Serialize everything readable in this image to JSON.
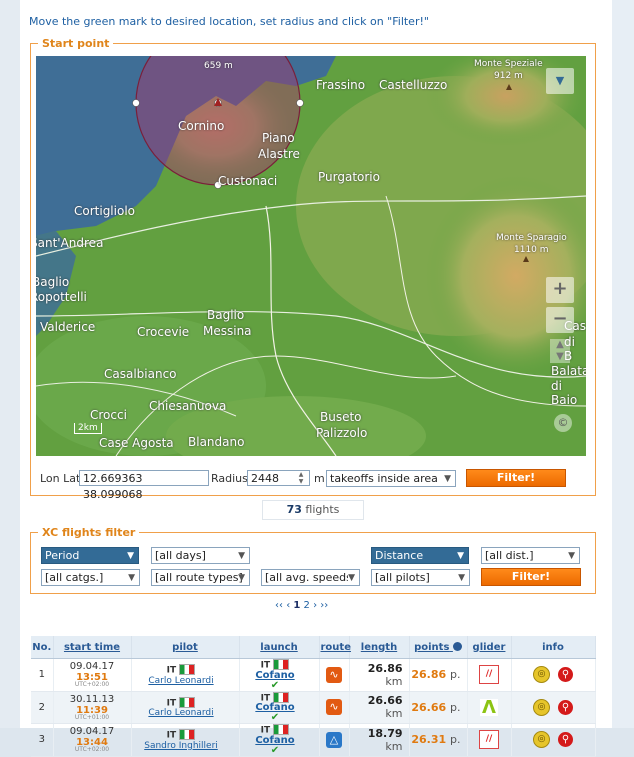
{
  "instruction": "Move the green mark to desired location, set radius and click on \"Filter!\"",
  "start_point": {
    "legend": "Start point",
    "map_labels": {
      "place1": "Frassino",
      "place2": "Castelluzzo",
      "peak1_name": "Monte Speziale",
      "peak1_elev": "912 m",
      "peak2_elev": "659 m",
      "place3": "Cornino",
      "place4": "Piano",
      "place4b": "Alastre",
      "place5": "Custonaci",
      "place6": "Purgatorio",
      "place7": "Cortigliolo",
      "place8": "Sant'Andrea",
      "peak3_name": "Monte Sparagio",
      "peak3_elev": "1110 m",
      "place9": "Baglio",
      "place9b": "Ropottelli",
      "place10": "Baglio",
      "place10b": "Messina",
      "place11": "Valderice",
      "place12": "Crocevie",
      "place13": "Casalbianco",
      "place14": "Chiesanuova",
      "place15": "Crocci",
      "place16": "Case Agosta",
      "place17": "Blandano",
      "place18": "Buseto",
      "place18b": "Palizzolo",
      "place19": "Balata",
      "place19b": "di Baio",
      "place20": "Cas",
      "place20b": "di B",
      "scale": "2km",
      "copyright": "©"
    },
    "zoom_in": "+",
    "zoom_out": "−",
    "layers": "▼",
    "lonlat_label": "Lon Lat",
    "lonlat_value": "12.669363 38.099068",
    "radius_label": "Radius",
    "radius_value": "2448",
    "radius_unit": "m",
    "area_select": "takeoffs inside area",
    "filter_button": "Filter!"
  },
  "flight_count": {
    "number": "73",
    "label": "flights"
  },
  "xc_filter": {
    "legend": "XC flights filter",
    "period": "Period",
    "days": "[all days]",
    "distance": "Distance",
    "dist": "[all dist.]",
    "catgs": "[all catgs.]",
    "route_types": "[all route types]",
    "avg_speeds": "[all avg. speeds",
    "pilots": "[all pilots]",
    "filter_button": "Filter!"
  },
  "pager": {
    "first": "‹‹",
    "prev": "‹",
    "page1": "1",
    "page2": "2",
    "next": "›",
    "last": "››"
  },
  "table": {
    "headers": {
      "no": "No.",
      "start_time": "start time",
      "pilot": "pilot",
      "launch": "launch",
      "route": "route",
      "length": "length",
      "points": "points",
      "glider": "glider",
      "info": "info"
    },
    "rows": [
      {
        "no": "1",
        "date": "09.04.17",
        "time": "13:51",
        "utc": "UTC+02:00",
        "pilot_cc": "IT",
        "pilot": "Carlo Leonardi",
        "launch_cc": "IT",
        "launch": "Cofano",
        "length": "26.86",
        "length_unit": "km",
        "points": "26.86",
        "points_unit": "p."
      },
      {
        "no": "2",
        "date": "30.11.13",
        "time": "11:39",
        "utc": "UTC+01:00",
        "pilot_cc": "IT",
        "pilot": "Carlo Leonardi",
        "launch_cc": "IT",
        "launch": "Cofano",
        "length": "26.66",
        "length_unit": "km",
        "points": "26.66",
        "points_unit": "p."
      },
      {
        "no": "3",
        "date": "09.04.17",
        "time": "13:44",
        "utc": "UTC+02:00",
        "pilot_cc": "IT",
        "pilot": "Sandro Inghilleri",
        "launch_cc": "IT",
        "launch": "Cofano",
        "length": "18.79",
        "length_unit": "km",
        "points": "26.31",
        "points_unit": "p."
      }
    ]
  }
}
